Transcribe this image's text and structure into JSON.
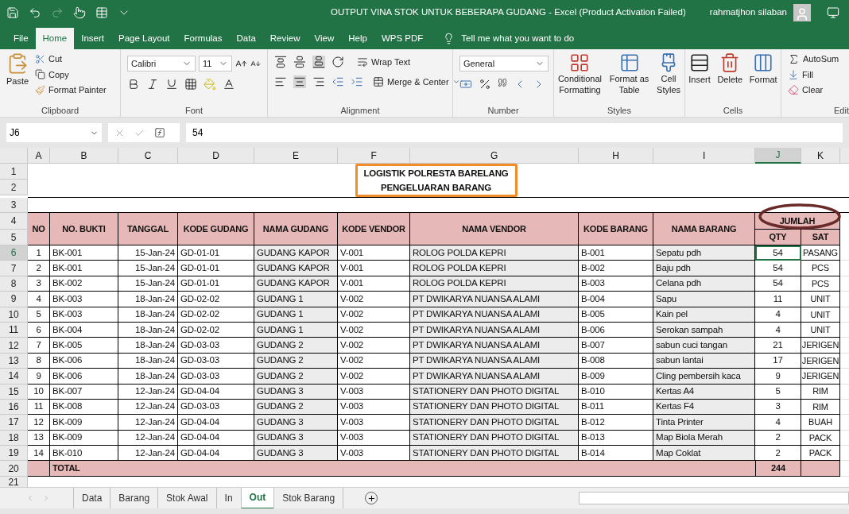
{
  "title_bar": {
    "title": "OUTPUT VINA STOK UNTUK BEBERAPA GUDANG  -  Excel (Product Activation Failed)",
    "user": "rahmatjhon silaban"
  },
  "menu_tabs": [
    {
      "label": "File",
      "selected": false
    },
    {
      "label": "Home",
      "selected": true
    },
    {
      "label": "Insert",
      "selected": false
    },
    {
      "label": "Page Layout",
      "selected": false
    },
    {
      "label": "Formulas",
      "selected": false
    },
    {
      "label": "Data",
      "selected": false
    },
    {
      "label": "Review",
      "selected": false
    },
    {
      "label": "View",
      "selected": false
    },
    {
      "label": "Help",
      "selected": false
    },
    {
      "label": "WPS PDF",
      "selected": false
    }
  ],
  "tell_me": "Tell me what you want to do",
  "ribbon": {
    "clipboard": {
      "paste": "Paste",
      "cut": "Cut",
      "copy": "Copy",
      "format_painter": "Format Painter",
      "label": "Clipboard"
    },
    "font": {
      "name": "Calibri",
      "size": "11",
      "label": "Font"
    },
    "alignment": {
      "wrap_text": "Wrap Text",
      "merge": "Merge & Center",
      "label": "Alignment"
    },
    "number": {
      "format": "General",
      "label": "Number"
    },
    "styles": {
      "buttons": [
        [
          "Conditional",
          "Formatting"
        ],
        [
          "Format as",
          "Table"
        ],
        [
          "Cell",
          "Styles"
        ]
      ],
      "label": "Styles"
    },
    "cells": {
      "buttons": [
        "Insert",
        "Delete",
        "Format"
      ],
      "label": "Cells"
    },
    "editing": {
      "autosum": "AutoSum",
      "fill": "Fill",
      "clear": "Clear",
      "label": "Edit"
    }
  },
  "formula_bar": {
    "name_box": "J6",
    "formula": "54"
  },
  "columns": [
    {
      "label": "A",
      "selected": false
    },
    {
      "label": "B",
      "selected": false
    },
    {
      "label": "C",
      "selected": false
    },
    {
      "label": "D",
      "selected": false
    },
    {
      "label": "E",
      "selected": false
    },
    {
      "label": "F",
      "selected": false
    },
    {
      "label": "G",
      "selected": false
    },
    {
      "label": "H",
      "selected": false
    },
    {
      "label": "I",
      "selected": false
    },
    {
      "label": "J",
      "selected": true
    },
    {
      "label": "K",
      "selected": false
    }
  ],
  "row_headers": [
    {
      "label": "1",
      "selected": false
    },
    {
      "label": "2",
      "selected": false
    },
    {
      "label": "3",
      "selected": false
    },
    {
      "label": "4",
      "selected": false
    },
    {
      "label": "5",
      "selected": false
    },
    {
      "label": "6",
      "selected": true
    },
    {
      "label": "7",
      "selected": false
    },
    {
      "label": "8",
      "selected": false
    },
    {
      "label": "9",
      "selected": false
    },
    {
      "label": "10",
      "selected": false
    },
    {
      "label": "11",
      "selected": false
    },
    {
      "label": "12",
      "selected": false
    },
    {
      "label": "13",
      "selected": false
    },
    {
      "label": "14",
      "selected": false
    },
    {
      "label": "15",
      "selected": false
    },
    {
      "label": "16",
      "selected": false
    },
    {
      "label": "17",
      "selected": false
    },
    {
      "label": "18",
      "selected": false
    },
    {
      "label": "19",
      "selected": false
    },
    {
      "label": "20",
      "selected": false
    },
    {
      "label": "21",
      "selected": false
    }
  ],
  "sheet": {
    "title": {
      "lines": [
        "LOGISTIK POLRESTA BARELANG",
        "PENGELUARAN BARANG"
      ],
      "outlined": true
    },
    "headers": [
      "NO",
      "NO. BUKTI",
      "TANGGAL",
      "KODE GUDANG",
      "NAMA GUDANG",
      "KODE VENDOR",
      "NAMA VENDOR",
      "KODE BARANG",
      "NAMA BARANG"
    ],
    "group_header": {
      "label": "JUMLAH",
      "circled": true,
      "sub": [
        "QTY",
        "SAT"
      ]
    },
    "rows": [
      {
        "cells": [
          "1",
          "BK-001",
          "15-Jan-24",
          "GD-01-01",
          "GUDANG KAPOR",
          "V-001",
          "ROLOG POLDA KEPRI",
          "B-001",
          "Sepatu pdh",
          "54",
          "PASANG"
        ],
        "qty_active": true
      },
      {
        "cells": [
          "2",
          "BK-001",
          "15-Jan-24",
          "GD-01-01",
          "GUDANG KAPOR",
          "V-001",
          "ROLOG POLDA KEPRI",
          "B-002",
          "Baju pdh",
          "54",
          "PCS"
        ],
        "qty_active": false
      },
      {
        "cells": [
          "3",
          "BK-002",
          "15-Jan-24",
          "GD-01-01",
          "GUDANG KAPOR",
          "V-001",
          "ROLOG POLDA KEPRI",
          "B-003",
          "Celana pdh",
          "54",
          "PCS"
        ],
        "qty_active": false
      },
      {
        "cells": [
          "4",
          "BK-003",
          "18-Jan-24",
          "GD-02-02",
          "GUDANG 1",
          "V-002",
          "PT DWIKARYA NUANSA ALAMI",
          "B-004",
          "Sapu",
          "11",
          "UNIT"
        ],
        "qty_active": false
      },
      {
        "cells": [
          "5",
          "BK-003",
          "18-Jan-24",
          "GD-02-02",
          "GUDANG 1",
          "V-002",
          "PT DWIKARYA NUANSA ALAMI",
          "B-005",
          "Kain pel",
          "4",
          "UNIT"
        ],
        "qty_active": false
      },
      {
        "cells": [
          "6",
          "BK-004",
          "18-Jan-24",
          "GD-02-02",
          "GUDANG 1",
          "V-002",
          "PT DWIKARYA NUANSA ALAMI",
          "B-006",
          "Serokan sampah",
          "4",
          "UNIT"
        ],
        "qty_active": false
      },
      {
        "cells": [
          "7",
          "BK-005",
          "18-Jan-24",
          "GD-03-03",
          "GUDANG 2",
          "V-002",
          "PT DWIKARYA NUANSA ALAMI",
          "B-007",
          "sabun cuci tangan",
          "21",
          "JERIGEN"
        ],
        "qty_active": false
      },
      {
        "cells": [
          "8",
          "BK-006",
          "18-Jan-24",
          "GD-03-03",
          "GUDANG 2",
          "V-002",
          "PT DWIKARYA NUANSA ALAMI",
          "B-008",
          "sabun lantai",
          "17",
          "JERIGEN"
        ],
        "qty_active": false
      },
      {
        "cells": [
          "9",
          "BK-006",
          "18-Jan-24",
          "GD-03-03",
          "GUDANG 2",
          "V-002",
          "PT DWIKARYA NUANSA ALAMI",
          "B-009",
          "Cling pembersih kaca",
          "9",
          "JERIGEN"
        ],
        "qty_active": false
      },
      {
        "cells": [
          "10",
          "BK-007",
          "12-Jan-24",
          "GD-04-04",
          "GUDANG 3",
          "V-003",
          "STATIONERY DAN PHOTO DIGITAL",
          "B-010",
          "Kertas A4",
          "5",
          "RIM"
        ],
        "qty_active": false
      },
      {
        "cells": [
          "11",
          "BK-008",
          "12-Jan-24",
          "GD-03-03",
          "GUDANG 2",
          "V-003",
          "STATIONERY DAN PHOTO DIGITAL",
          "B-011",
          "Kertas F4",
          "3",
          "RIM"
        ],
        "qty_active": false
      },
      {
        "cells": [
          "12",
          "BK-009",
          "12-Jan-24",
          "GD-04-04",
          "GUDANG 3",
          "V-003",
          "STATIONERY DAN PHOTO DIGITAL",
          "B-012",
          "Tinta Printer",
          "4",
          "BUAH"
        ],
        "qty_active": false
      },
      {
        "cells": [
          "13",
          "BK-009",
          "12-Jan-24",
          "GD-04-04",
          "GUDANG 3",
          "V-003",
          "STATIONERY DAN PHOTO DIGITAL",
          "B-013",
          "Map Biola Merah",
          "2",
          "PACK"
        ],
        "qty_active": false
      },
      {
        "cells": [
          "14",
          "BK-010",
          "12-Jan-24",
          "GD-04-04",
          "GUDANG 3",
          "V-003",
          "STATIONERY DAN PHOTO DIGITAL",
          "B-014",
          "Map Coklat",
          "2",
          "PACK"
        ],
        "qty_active": false
      }
    ],
    "total": {
      "label": "TOTAL",
      "qty": "244"
    }
  },
  "sheet_tabs": [
    {
      "label": "Data",
      "selected": false
    },
    {
      "label": "Barang",
      "selected": false
    },
    {
      "label": "Stok Awal",
      "selected": false
    },
    {
      "label": "In",
      "selected": false
    },
    {
      "label": "Out",
      "selected": true
    },
    {
      "label": "Stok Barang",
      "selected": false
    }
  ]
}
